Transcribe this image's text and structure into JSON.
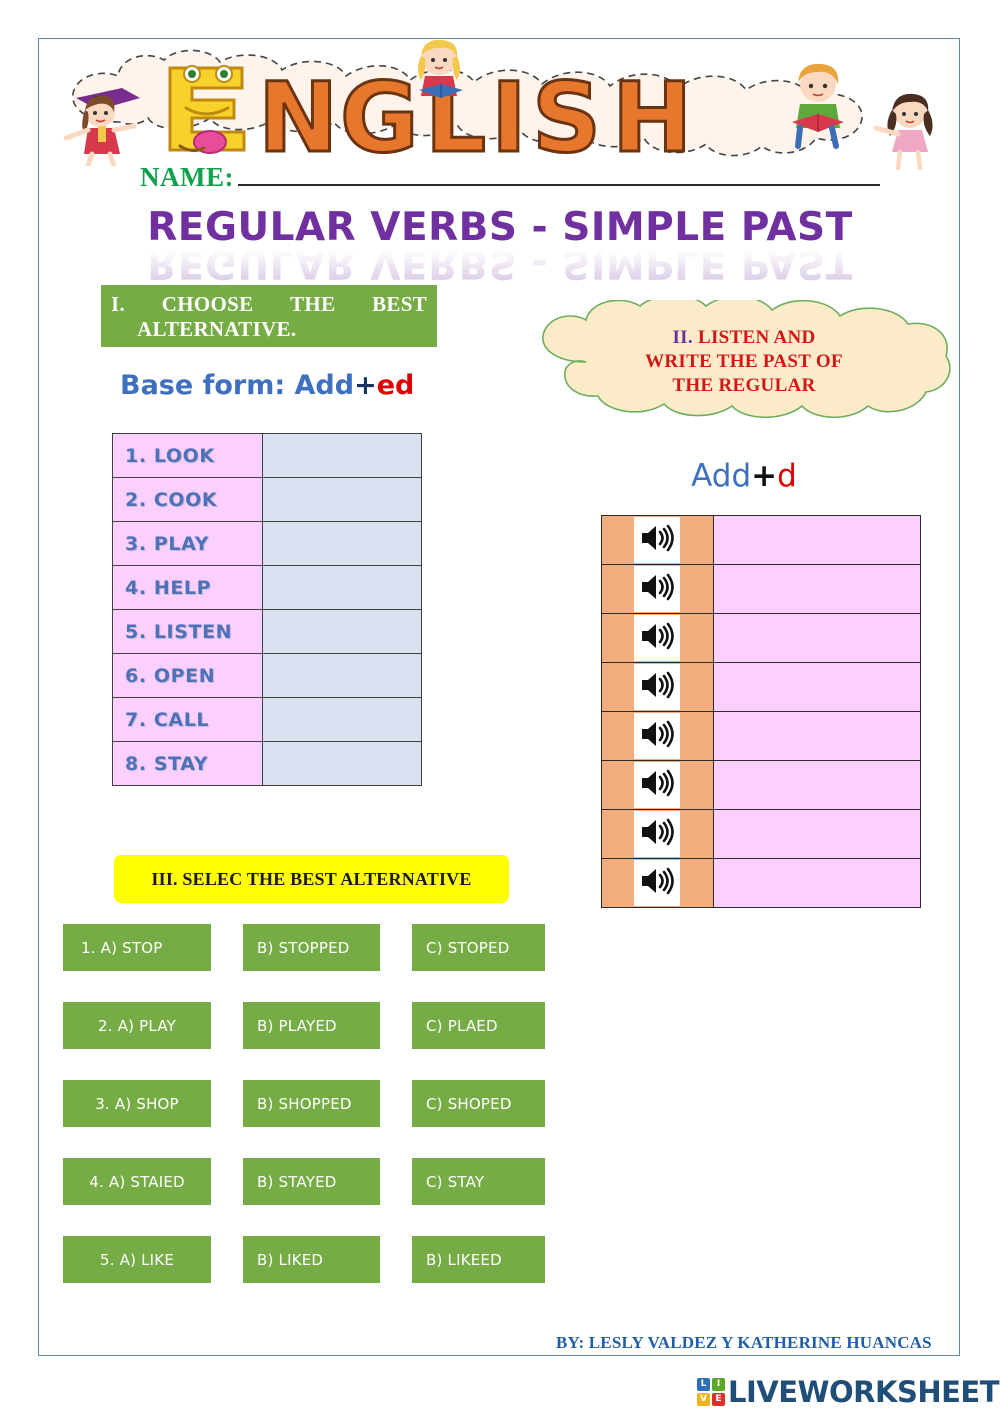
{
  "header": {
    "logo_word": "ENGLISH",
    "logo_letters": [
      "E",
      "N",
      "G",
      "L",
      "I",
      "S",
      "H"
    ],
    "name_label": "NAME:",
    "name_value": ""
  },
  "title": {
    "text": "REGULAR VERBS - SIMPLE PAST"
  },
  "section1": {
    "heading_number": "I.",
    "heading_words": [
      "CHOOSE",
      "THE",
      "BEST"
    ],
    "heading_line2": "ALTERNATIVE.",
    "rule_prefix": "Base form: Add",
    "rule_plus": "+",
    "rule_suffix": "ed",
    "rows": [
      {
        "verb": "1. LOOK",
        "answer": ""
      },
      {
        "verb": "2. COOK",
        "answer": ""
      },
      {
        "verb": "3. PLAY",
        "answer": ""
      },
      {
        "verb": "4.  HELP",
        "answer": ""
      },
      {
        "verb": "5. LISTEN",
        "answer": ""
      },
      {
        "verb": "6. OPEN",
        "answer": ""
      },
      {
        "verb": "7. CALL",
        "answer": ""
      },
      {
        "verb": "8. STAY",
        "answer": ""
      }
    ]
  },
  "section2": {
    "heading_number": "II.",
    "heading_line1_rest": "LISTEN AND",
    "heading_line2": "WRITE THE PAST OF",
    "heading_line3": "THE REGULAR",
    "rule_prefix": "Add",
    "rule_plus": "+",
    "rule_suffix": "d",
    "audio_icon": "speaker-icon",
    "rows": [
      {
        "audio": "speaker-icon",
        "answer": ""
      },
      {
        "audio": "speaker-icon",
        "answer": ""
      },
      {
        "audio": "speaker-icon",
        "answer": ""
      },
      {
        "audio": "speaker-icon",
        "answer": ""
      },
      {
        "audio": "speaker-icon",
        "answer": ""
      },
      {
        "audio": "speaker-icon",
        "answer": ""
      },
      {
        "audio": "speaker-icon",
        "answer": ""
      },
      {
        "audio": "speaker-icon",
        "answer": ""
      }
    ]
  },
  "section3": {
    "heading": "III. SELEC THE BEST ALTERNATIVE",
    "questions": [
      {
        "a": "1.  A) STOP",
        "b": "B) STOPPED",
        "c": "C) STOPED"
      },
      {
        "a": "2. A) PLAY",
        "b": "B) PLAYED",
        "c": "C) PLAED"
      },
      {
        "a": "3. A) SHOP",
        "b": "B) SHOPPED",
        "c": "C) SHOPED"
      },
      {
        "a": "4. A) STAIED",
        "b": "B) STAYED",
        "c": "C) STAY"
      },
      {
        "a": "5. A) LIKE",
        "b": "B) LIKED",
        "c": "B) LIKEED"
      }
    ]
  },
  "footer": {
    "byline": "BY: LESLY VALDEZ Y KATHERINE HUANCAS",
    "logo_tiles": [
      {
        "letter": "L",
        "color": "#2E6FB7"
      },
      {
        "letter": "I",
        "color": "#5BA829"
      },
      {
        "letter": "V",
        "color": "#F0B323"
      },
      {
        "letter": "E",
        "color": "#D8322B"
      }
    ],
    "logo_word": "LIVEWORKSHEETS"
  },
  "colors": {
    "page_border": "#5B8AAE",
    "green": "#76AC46",
    "title_purple": "#7030A0",
    "verb_pink": "#FBD0FF",
    "verb_answer_blue": "#D9E1F0",
    "listen_orange": "#F2AC7D",
    "yellow": "#FFFF00",
    "red": "#D31717",
    "blue_text": "#3F6FBF",
    "name_green": "#11A04B",
    "byline_blue": "#1F5FA8"
  }
}
